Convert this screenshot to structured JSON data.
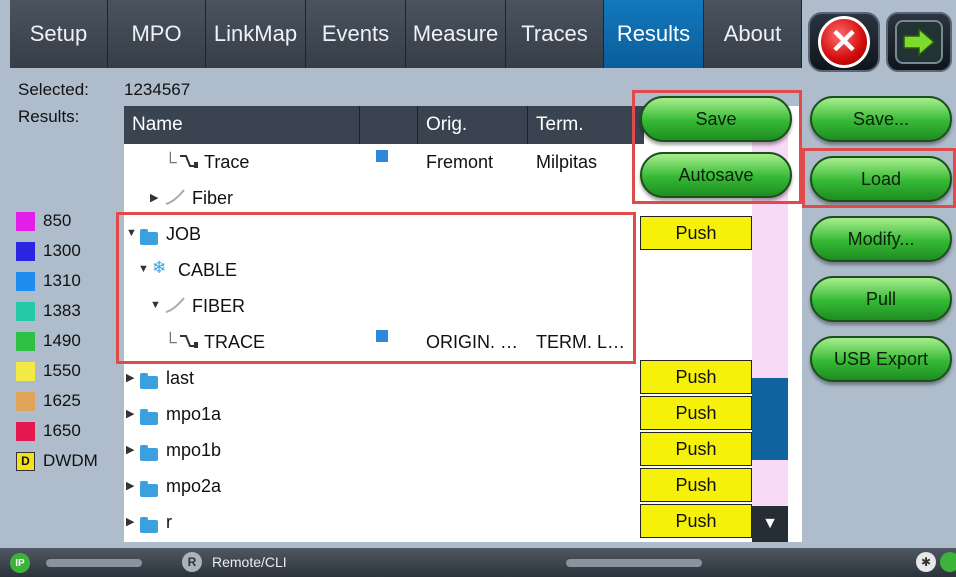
{
  "tabs": [
    {
      "label": "Setup",
      "active": false
    },
    {
      "label": "MPO",
      "active": false
    },
    {
      "label": "LinkMap",
      "active": false
    },
    {
      "label": "Events",
      "active": false
    },
    {
      "label": "Measure",
      "active": false
    },
    {
      "label": "Traces",
      "active": false
    },
    {
      "label": "Results",
      "active": true
    },
    {
      "label": "About",
      "active": false
    }
  ],
  "selected": {
    "label": "Selected:",
    "value": "1234567"
  },
  "results_label": "Results:",
  "table": {
    "headers": {
      "name": "Name",
      "orig": "Orig.",
      "term": "Term."
    },
    "rows": [
      {
        "name": "Trace",
        "orig": "Fremont",
        "term": "Milpitas",
        "icon": "trace-icon"
      },
      {
        "name": "Fiber",
        "orig": "",
        "term": "",
        "icon": "fiber-icon"
      },
      {
        "name": "JOB",
        "orig": "",
        "term": "",
        "icon": "folder-icon"
      },
      {
        "name": "CABLE",
        "orig": "",
        "term": "",
        "icon": "cable-icon"
      },
      {
        "name": "FIBER",
        "orig": "",
        "term": "",
        "icon": "fiber-icon"
      },
      {
        "name": "TRACE",
        "orig": "ORIGIN. …",
        "term": "TERM. L…",
        "icon": "trace-icon"
      },
      {
        "name": "last",
        "orig": "",
        "term": "",
        "icon": "folder-icon"
      },
      {
        "name": "mpo1a",
        "orig": "",
        "term": "",
        "icon": "folder-icon"
      },
      {
        "name": "mpo1b",
        "orig": "",
        "term": "",
        "icon": "folder-icon"
      },
      {
        "name": "mpo2a",
        "orig": "",
        "term": "",
        "icon": "folder-icon"
      },
      {
        "name": "r",
        "orig": "",
        "term": "",
        "icon": "folder-icon"
      }
    ],
    "push_label": "Push"
  },
  "legend": [
    {
      "label": "850",
      "color": "#e31ee8"
    },
    {
      "label": "1300",
      "color": "#2a25e0"
    },
    {
      "label": "1310",
      "color": "#1e8cf0"
    },
    {
      "label": "1383",
      "color": "#25c9a8"
    },
    {
      "label": "1490",
      "color": "#2fc143"
    },
    {
      "label": "1550",
      "color": "#f1ea47"
    },
    {
      "label": "1625",
      "color": "#e0a35a"
    },
    {
      "label": "1650",
      "color": "#e4184f"
    },
    {
      "label": "DWDM",
      "color": "#f2e21b",
      "icon_letter": "D"
    }
  ],
  "buttons": {
    "save": "Save",
    "autosave": "Autosave",
    "save_as": "Save...",
    "load": "Load",
    "modify": "Modify...",
    "pull": "Pull",
    "usb_export": "USB Export"
  },
  "status_bar": {
    "remote": "Remote/CLI",
    "ip_badge": "IP",
    "r_badge": "R"
  }
}
